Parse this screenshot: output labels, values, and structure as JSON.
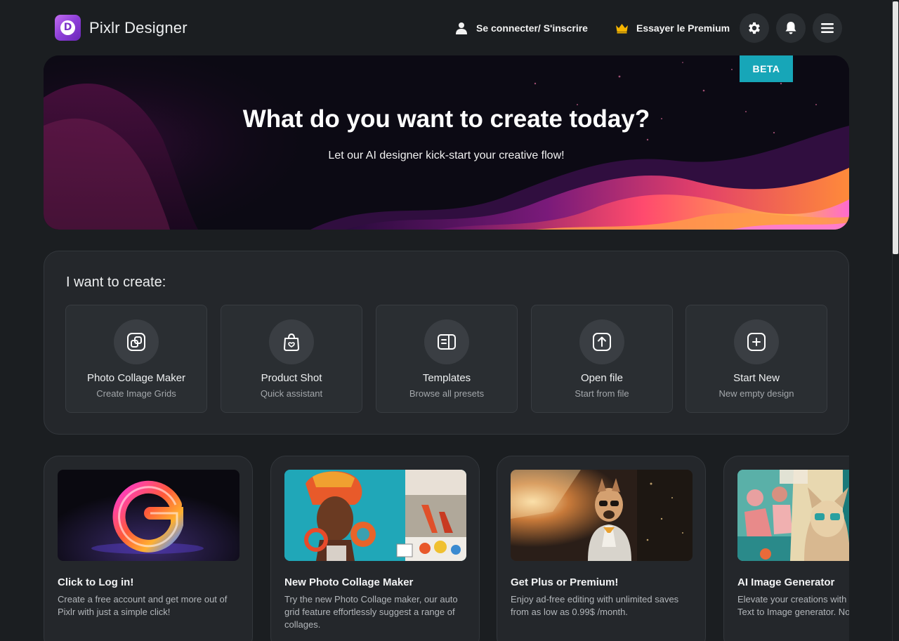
{
  "header": {
    "app_title": "Pixlr Designer",
    "logo_letter": "D",
    "login_label": "Se connecter/ S'inscrire",
    "premium_label": "Essayer le Premium",
    "icons": [
      "user-icon",
      "crown-icon",
      "gear-icon",
      "bell-icon",
      "hamburger-menu-icon"
    ]
  },
  "hero": {
    "badge": "BETA",
    "title": "What do you want to create today?",
    "subtitle": "Let our AI designer kick-start your creative flow!"
  },
  "create": {
    "heading": "I want to create:",
    "items": [
      {
        "title": "Photo Collage Maker",
        "subtitle": "Create Image Grids",
        "icon": "collage-icon"
      },
      {
        "title": "Product Shot",
        "subtitle": "Quick assistant",
        "icon": "shopping-bag-icon"
      },
      {
        "title": "Templates",
        "subtitle": "Browse all presets",
        "icon": "template-icon"
      },
      {
        "title": "Open file",
        "subtitle": "Start from file",
        "icon": "upload-icon"
      },
      {
        "title": "Start New",
        "subtitle": "New empty design",
        "icon": "plus-square-icon"
      }
    ]
  },
  "features": [
    {
      "title": "Click to Log in!",
      "description": "Create a free account and get more out of Pixlr with just a simple click!"
    },
    {
      "title": "New Photo Collage Maker",
      "description": "Try the new Photo Collage maker, our auto grid feature effortlessly suggest a range of collages."
    },
    {
      "title": "Get Plus or Premium!",
      "description": "Enjoy ad-free editing with unlimited saves from as low as 0.99$ /month."
    },
    {
      "title": "AI Image Generator",
      "description": "Elevate your creations with revolutionary Text to Image generator. Now even better"
    }
  ],
  "colors": {
    "background": "#1b1e21",
    "panel": "#24272b",
    "beta_badge": "#17a6b8",
    "crown": "#f5b400",
    "brand_purple": "#8d3fd8"
  }
}
